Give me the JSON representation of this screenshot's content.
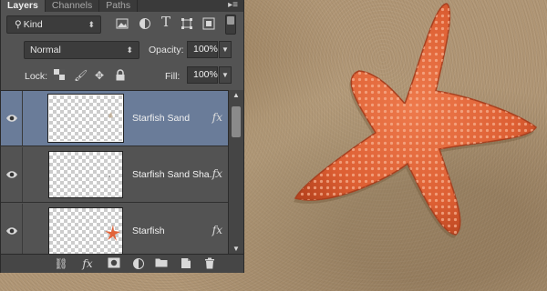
{
  "panel": {
    "tabs": [
      {
        "label": "Layers",
        "active": true
      },
      {
        "label": "Channels",
        "active": false
      },
      {
        "label": "Paths",
        "active": false
      }
    ],
    "menu_icon": "panel-menu-icon"
  },
  "filter": {
    "kind_label": "Kind",
    "icons": [
      "image-filter-icon",
      "adjustment-filter-icon",
      "type-filter-icon",
      "shape-filter-icon",
      "smart-object-filter-icon"
    ]
  },
  "blend": {
    "mode": "Normal",
    "opacity_label": "Opacity:",
    "opacity_value": "100%"
  },
  "lock": {
    "label": "Lock:",
    "fill_label": "Fill:",
    "fill_value": "100%"
  },
  "layers": [
    {
      "name": "Starfish Sand",
      "fx": "fx",
      "selected": true,
      "thumb": "sand"
    },
    {
      "name": "Starfish Sand Sha...",
      "fx": "fx",
      "selected": false,
      "thumb": "empty"
    },
    {
      "name": "Starfish",
      "fx": "fx",
      "selected": false,
      "thumb": "starfish"
    }
  ],
  "footer": {
    "fx_label": "fx"
  },
  "colors": {
    "panel_bg": "#535353",
    "selected_row": "#6a7c99",
    "starfish": "#e2643a"
  }
}
